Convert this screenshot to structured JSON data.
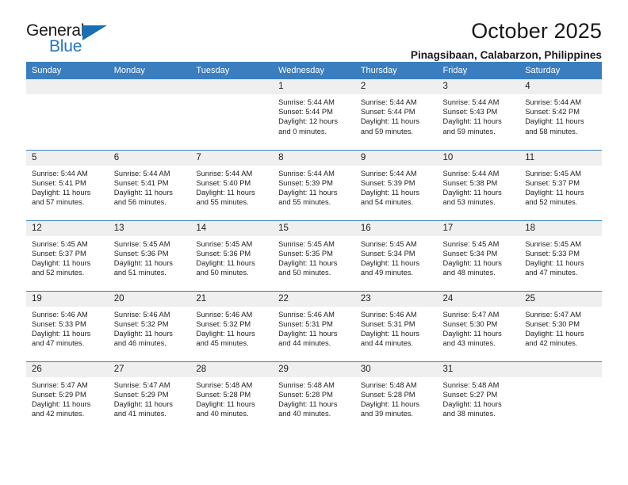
{
  "brand": {
    "name_dark": "General",
    "name_blue": "Blue",
    "accent_color": "#2176c7",
    "triangle_color": "#1a6fb4"
  },
  "header": {
    "title": "October 2025",
    "subtitle": "Pinagsibaan, Calabarzon, Philippines",
    "header_bg": "#3a7ebf",
    "daynum_bg": "#efefef"
  },
  "weekday_headers": [
    "Sunday",
    "Monday",
    "Tuesday",
    "Wednesday",
    "Thursday",
    "Friday",
    "Saturday"
  ],
  "labels": {
    "sunrise": "Sunrise:",
    "sunset": "Sunset:",
    "daylight": "Daylight:"
  },
  "weeks": [
    [
      {
        "day": "",
        "empty": true
      },
      {
        "day": "",
        "empty": true
      },
      {
        "day": "",
        "empty": true
      },
      {
        "day": "1",
        "sunrise": "Sunrise: 5:44 AM",
        "sunset": "Sunset: 5:44 PM",
        "daylight1": "Daylight: 12 hours",
        "daylight2": "and 0 minutes."
      },
      {
        "day": "2",
        "sunrise": "Sunrise: 5:44 AM",
        "sunset": "Sunset: 5:44 PM",
        "daylight1": "Daylight: 11 hours",
        "daylight2": "and 59 minutes."
      },
      {
        "day": "3",
        "sunrise": "Sunrise: 5:44 AM",
        "sunset": "Sunset: 5:43 PM",
        "daylight1": "Daylight: 11 hours",
        "daylight2": "and 59 minutes."
      },
      {
        "day": "4",
        "sunrise": "Sunrise: 5:44 AM",
        "sunset": "Sunset: 5:42 PM",
        "daylight1": "Daylight: 11 hours",
        "daylight2": "and 58 minutes."
      }
    ],
    [
      {
        "day": "5",
        "sunrise": "Sunrise: 5:44 AM",
        "sunset": "Sunset: 5:41 PM",
        "daylight1": "Daylight: 11 hours",
        "daylight2": "and 57 minutes."
      },
      {
        "day": "6",
        "sunrise": "Sunrise: 5:44 AM",
        "sunset": "Sunset: 5:41 PM",
        "daylight1": "Daylight: 11 hours",
        "daylight2": "and 56 minutes."
      },
      {
        "day": "7",
        "sunrise": "Sunrise: 5:44 AM",
        "sunset": "Sunset: 5:40 PM",
        "daylight1": "Daylight: 11 hours",
        "daylight2": "and 55 minutes."
      },
      {
        "day": "8",
        "sunrise": "Sunrise: 5:44 AM",
        "sunset": "Sunset: 5:39 PM",
        "daylight1": "Daylight: 11 hours",
        "daylight2": "and 55 minutes."
      },
      {
        "day": "9",
        "sunrise": "Sunrise: 5:44 AM",
        "sunset": "Sunset: 5:39 PM",
        "daylight1": "Daylight: 11 hours",
        "daylight2": "and 54 minutes."
      },
      {
        "day": "10",
        "sunrise": "Sunrise: 5:44 AM",
        "sunset": "Sunset: 5:38 PM",
        "daylight1": "Daylight: 11 hours",
        "daylight2": "and 53 minutes."
      },
      {
        "day": "11",
        "sunrise": "Sunrise: 5:45 AM",
        "sunset": "Sunset: 5:37 PM",
        "daylight1": "Daylight: 11 hours",
        "daylight2": "and 52 minutes."
      }
    ],
    [
      {
        "day": "12",
        "sunrise": "Sunrise: 5:45 AM",
        "sunset": "Sunset: 5:37 PM",
        "daylight1": "Daylight: 11 hours",
        "daylight2": "and 52 minutes."
      },
      {
        "day": "13",
        "sunrise": "Sunrise: 5:45 AM",
        "sunset": "Sunset: 5:36 PM",
        "daylight1": "Daylight: 11 hours",
        "daylight2": "and 51 minutes."
      },
      {
        "day": "14",
        "sunrise": "Sunrise: 5:45 AM",
        "sunset": "Sunset: 5:36 PM",
        "daylight1": "Daylight: 11 hours",
        "daylight2": "and 50 minutes."
      },
      {
        "day": "15",
        "sunrise": "Sunrise: 5:45 AM",
        "sunset": "Sunset: 5:35 PM",
        "daylight1": "Daylight: 11 hours",
        "daylight2": "and 50 minutes."
      },
      {
        "day": "16",
        "sunrise": "Sunrise: 5:45 AM",
        "sunset": "Sunset: 5:34 PM",
        "daylight1": "Daylight: 11 hours",
        "daylight2": "and 49 minutes."
      },
      {
        "day": "17",
        "sunrise": "Sunrise: 5:45 AM",
        "sunset": "Sunset: 5:34 PM",
        "daylight1": "Daylight: 11 hours",
        "daylight2": "and 48 minutes."
      },
      {
        "day": "18",
        "sunrise": "Sunrise: 5:45 AM",
        "sunset": "Sunset: 5:33 PM",
        "daylight1": "Daylight: 11 hours",
        "daylight2": "and 47 minutes."
      }
    ],
    [
      {
        "day": "19",
        "sunrise": "Sunrise: 5:46 AM",
        "sunset": "Sunset: 5:33 PM",
        "daylight1": "Daylight: 11 hours",
        "daylight2": "and 47 minutes."
      },
      {
        "day": "20",
        "sunrise": "Sunrise: 5:46 AM",
        "sunset": "Sunset: 5:32 PM",
        "daylight1": "Daylight: 11 hours",
        "daylight2": "and 46 minutes."
      },
      {
        "day": "21",
        "sunrise": "Sunrise: 5:46 AM",
        "sunset": "Sunset: 5:32 PM",
        "daylight1": "Daylight: 11 hours",
        "daylight2": "and 45 minutes."
      },
      {
        "day": "22",
        "sunrise": "Sunrise: 5:46 AM",
        "sunset": "Sunset: 5:31 PM",
        "daylight1": "Daylight: 11 hours",
        "daylight2": "and 44 minutes."
      },
      {
        "day": "23",
        "sunrise": "Sunrise: 5:46 AM",
        "sunset": "Sunset: 5:31 PM",
        "daylight1": "Daylight: 11 hours",
        "daylight2": "and 44 minutes."
      },
      {
        "day": "24",
        "sunrise": "Sunrise: 5:47 AM",
        "sunset": "Sunset: 5:30 PM",
        "daylight1": "Daylight: 11 hours",
        "daylight2": "and 43 minutes."
      },
      {
        "day": "25",
        "sunrise": "Sunrise: 5:47 AM",
        "sunset": "Sunset: 5:30 PM",
        "daylight1": "Daylight: 11 hours",
        "daylight2": "and 42 minutes."
      }
    ],
    [
      {
        "day": "26",
        "sunrise": "Sunrise: 5:47 AM",
        "sunset": "Sunset: 5:29 PM",
        "daylight1": "Daylight: 11 hours",
        "daylight2": "and 42 minutes."
      },
      {
        "day": "27",
        "sunrise": "Sunrise: 5:47 AM",
        "sunset": "Sunset: 5:29 PM",
        "daylight1": "Daylight: 11 hours",
        "daylight2": "and 41 minutes."
      },
      {
        "day": "28",
        "sunrise": "Sunrise: 5:48 AM",
        "sunset": "Sunset: 5:28 PM",
        "daylight1": "Daylight: 11 hours",
        "daylight2": "and 40 minutes."
      },
      {
        "day": "29",
        "sunrise": "Sunrise: 5:48 AM",
        "sunset": "Sunset: 5:28 PM",
        "daylight1": "Daylight: 11 hours",
        "daylight2": "and 40 minutes."
      },
      {
        "day": "30",
        "sunrise": "Sunrise: 5:48 AM",
        "sunset": "Sunset: 5:28 PM",
        "daylight1": "Daylight: 11 hours",
        "daylight2": "and 39 minutes."
      },
      {
        "day": "31",
        "sunrise": "Sunrise: 5:48 AM",
        "sunset": "Sunset: 5:27 PM",
        "daylight1": "Daylight: 11 hours",
        "daylight2": "and 38 minutes."
      },
      {
        "day": "",
        "empty": true
      }
    ]
  ]
}
